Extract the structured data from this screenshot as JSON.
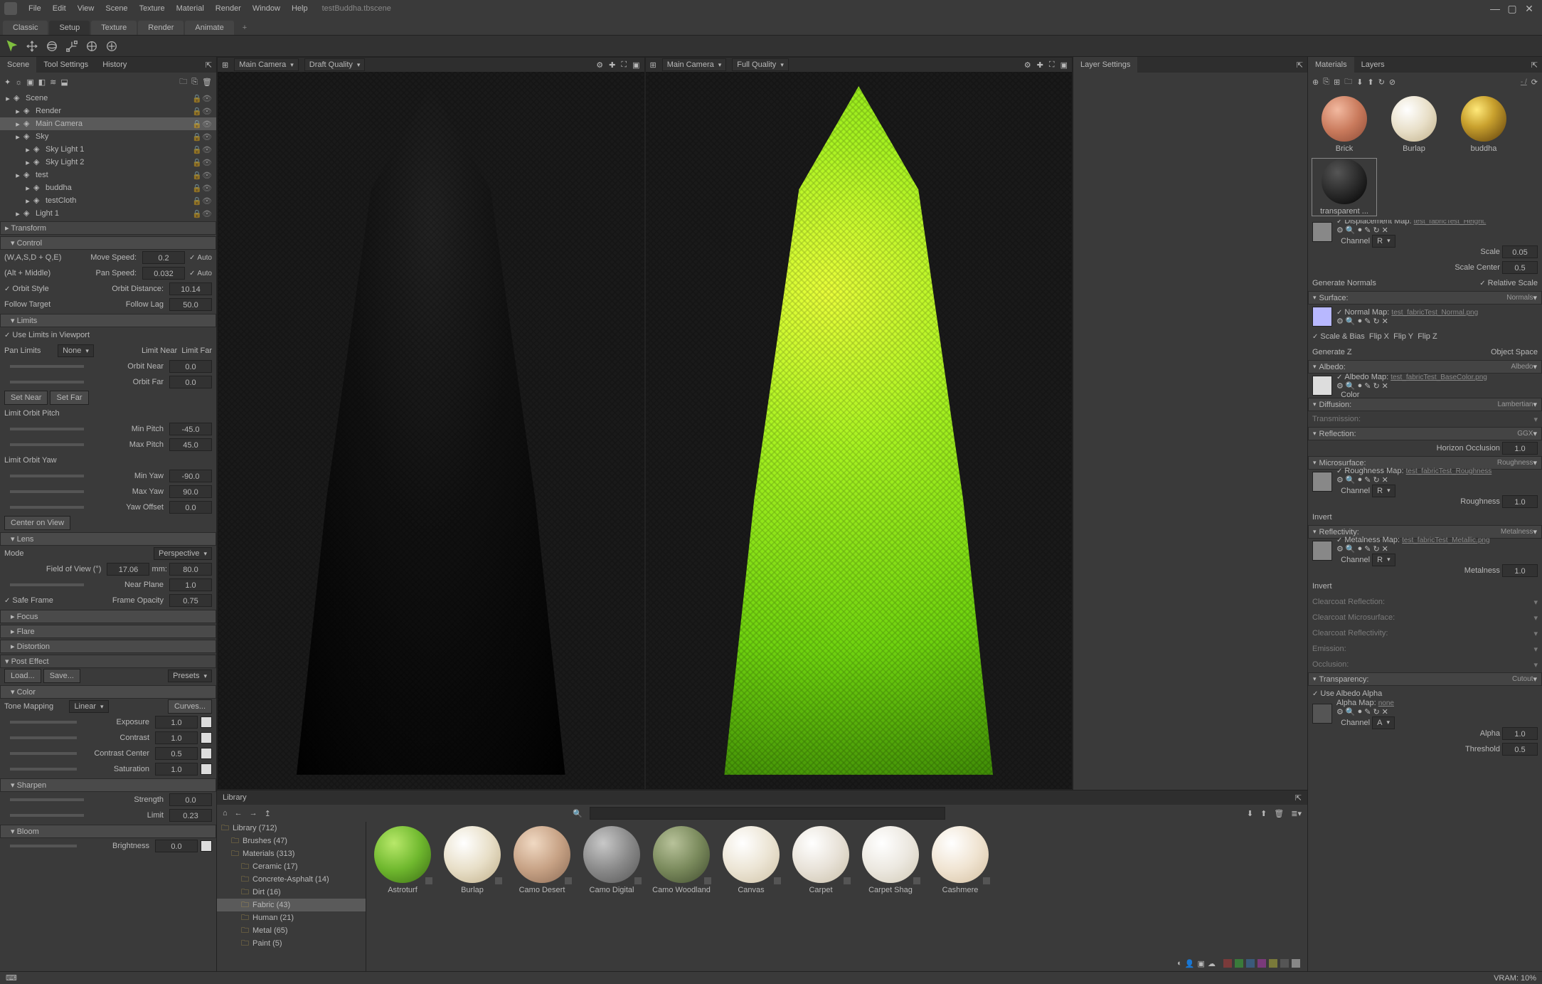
{
  "menu": {
    "items": [
      "File",
      "Edit",
      "View",
      "Scene",
      "Texture",
      "Material",
      "Render",
      "Window",
      "Help"
    ],
    "filename": "testBuddha.tbscene"
  },
  "workspace_tabs": [
    "Classic",
    "Setup",
    "Texture",
    "Render",
    "Animate"
  ],
  "workspace_active": 1,
  "left_tabs": [
    "Scene",
    "Tool Settings",
    "History"
  ],
  "hierarchy": [
    {
      "name": "Scene",
      "depth": 0,
      "sel": false,
      "icon": "scene"
    },
    {
      "name": "Render",
      "depth": 1,
      "sel": false,
      "icon": "render"
    },
    {
      "name": "Main Camera",
      "depth": 1,
      "sel": true,
      "icon": "camera"
    },
    {
      "name": "Sky",
      "depth": 1,
      "sel": false,
      "icon": "sky"
    },
    {
      "name": "Sky Light 1",
      "depth": 2,
      "sel": false,
      "icon": "light"
    },
    {
      "name": "Sky Light 2",
      "depth": 2,
      "sel": false,
      "icon": "light"
    },
    {
      "name": "test",
      "depth": 1,
      "sel": false,
      "icon": "folder"
    },
    {
      "name": "buddha",
      "depth": 2,
      "sel": false,
      "icon": "mesh"
    },
    {
      "name": "testCloth",
      "depth": 2,
      "sel": false,
      "icon": "mesh"
    },
    {
      "name": "Light 1",
      "depth": 1,
      "sel": false,
      "icon": "light"
    }
  ],
  "sections": {
    "transform": "Transform",
    "control": "Control",
    "limits": "Limits",
    "lens": "Lens",
    "focus": "Focus",
    "flare": "Flare",
    "distortion": "Distortion",
    "posteffect": "Post Effect",
    "color": "Color",
    "sharpen": "Sharpen",
    "bloom": "Bloom"
  },
  "control": {
    "wasd": "(W,A,S,D + Q,E)",
    "movespeed_lbl": "Move Speed:",
    "movespeed": "0.2",
    "auto": "Auto",
    "altmid": "(Alt + Middle)",
    "panspeed_lbl": "Pan Speed:",
    "panspeed": "0.032",
    "orbitstyle": "Orbit Style",
    "orbitdist_lbl": "Orbit Distance:",
    "orbitdist": "10.14",
    "followtarget": "Follow Target",
    "followlag_lbl": "Follow Lag",
    "followlag": "50.0"
  },
  "limits": {
    "uselimits": "Use Limits in Viewport",
    "panlimits_lbl": "Pan Limits",
    "panlimits_val": "None",
    "limitnear": "Limit Near",
    "limitfar": "Limit Far",
    "orbitnear": "Orbit Near",
    "orbitnear_v": "0.0",
    "orbitfar": "Orbit Far",
    "orbitfar_v": "0.0",
    "setnear": "Set Near",
    "setfar": "Set Far",
    "limitpitch": "Limit Orbit Pitch",
    "minpitch": "Min Pitch",
    "minpitch_v": "-45.0",
    "maxpitch": "Max Pitch",
    "maxpitch_v": "45.0",
    "limityaw": "Limit Orbit Yaw",
    "minyaw": "Min Yaw",
    "minyaw_v": "-90.0",
    "maxyaw": "Max Yaw",
    "maxyaw_v": "90.0",
    "yawoffset": "Yaw Offset",
    "yawoffset_v": "0.0",
    "centerview": "Center on View"
  },
  "lens": {
    "mode_lbl": "Mode",
    "mode": "Perspective",
    "fov_lbl": "Field of View (°)",
    "fov": "17.06",
    "mm_lbl": "mm:",
    "mm": "80.0",
    "nearplane": "Near Plane",
    "nearplane_v": "1.0",
    "safeframe": "Safe Frame",
    "frameop_lbl": "Frame Opacity",
    "frameop_v": "0.75"
  },
  "post": {
    "load": "Load...",
    "save": "Save...",
    "presets": "Presets",
    "tonemap_lbl": "Tone Mapping",
    "tonemap": "Linear",
    "curves": "Curves...",
    "exposure": "Exposure",
    "exposure_v": "1.0",
    "contrast": "Contrast",
    "contrast_v": "1.0",
    "contrastc": "Contrast Center",
    "contrastc_v": "0.5",
    "saturation": "Saturation",
    "saturation_v": "1.0",
    "strength": "Strength",
    "strength_v": "0.0",
    "limit": "Limit",
    "limit_v": "0.23",
    "brightness": "Brightness",
    "brightness_v": "0.0"
  },
  "viewport": {
    "cam": "Main Camera",
    "q1": "Draft Quality",
    "q2": "Full Quality"
  },
  "layer_tab": "Layer Settings",
  "right_tabs": [
    "Materials",
    "Layers"
  ],
  "materials": [
    {
      "name": "Brick",
      "bg": "radial-gradient(circle at 35% 30%,#f2b9a0 0%,#c97a5c 50%,#8a4a36 100%)"
    },
    {
      "name": "Burlap",
      "bg": "radial-gradient(circle at 35% 30%,#fff 0%,#e8dfc8 50%,#bfae88 100%)"
    },
    {
      "name": "buddha",
      "bg": "radial-gradient(circle at 35% 30%,#ffe97a 0%,#c9a12e 40%,#5a3a0a 100%)"
    },
    {
      "name": "transparent ...",
      "bg": "radial-gradient(circle at 35% 30%,#555 0%,#222 60%,#000 100%)",
      "sel": true
    }
  ],
  "matprops": {
    "displacement_sect": "Displacement Map:",
    "displacement_file": "test_fabricTest_Height.",
    "channel": "Channel",
    "channel_r": "R",
    "scale": "Scale",
    "scale_v": "0.05",
    "scalecenter": "Scale Center",
    "scalecenter_v": "0.5",
    "gennormals": "Generate Normals",
    "relscale": "Relative Scale",
    "surface": "Surface:",
    "surface_mode": "Normals",
    "normalmap": "Normal Map:",
    "normal_file": "test_fabricTest_Normal.png",
    "scalebias": "Scale & Bias",
    "flipx": "Flip X",
    "flipy": "Flip Y",
    "flipz": "Flip Z",
    "genz": "Generate Z",
    "objspace": "Object Space",
    "albedo": "Albedo:",
    "albedo_mode": "Albedo",
    "albedomap": "Albedo Map:",
    "albedo_file": "test_fabricTest_BaseColor.png",
    "color": "Color",
    "diffusion": "Diffusion:",
    "diffusion_mode": "Lambertian",
    "transmission": "Transmission:",
    "reflection": "Reflection:",
    "reflection_mode": "GGX",
    "horizocc": "Horizon Occlusion",
    "horizocc_v": "1.0",
    "microsurface": "Microsurface:",
    "microsurface_mode": "Roughness",
    "roughmap": "Roughness Map:",
    "rough_file": "test_fabricTest_Roughness",
    "roughness": "Roughness",
    "roughness_v": "1.0",
    "invert": "Invert",
    "reflectivity": "Reflectivity:",
    "reflectivity_mode": "Metalness",
    "metalmap": "Metalness Map:",
    "metal_file": "test_fabricTest_Metallic.png",
    "metalness": "Metalness",
    "metalness_v": "1.0",
    "ccrefl": "Clearcoat Reflection:",
    "ccmicro": "Clearcoat Microsurface:",
    "ccreflv": "Clearcoat Reflectivity:",
    "emission": "Emission:",
    "occlusion": "Occlusion:",
    "transparency": "Transparency:",
    "transparency_mode": "Cutout",
    "usealbedo": "Use Albedo Alpha",
    "alphamap": "Alpha Map:",
    "alphamap_v": "none",
    "channel_a": "A",
    "alpha": "Alpha",
    "alpha_v": "1.0",
    "threshold": "Threshold",
    "threshold_v": "0.5"
  },
  "library": {
    "title": "Library",
    "search_ph": "",
    "tree": [
      {
        "name": "Library (712)",
        "depth": 0
      },
      {
        "name": "Brushes (47)",
        "depth": 1
      },
      {
        "name": "Materials (313)",
        "depth": 1
      },
      {
        "name": "Ceramic (17)",
        "depth": 2
      },
      {
        "name": "Concrete-Asphalt (14)",
        "depth": 2
      },
      {
        "name": "Dirt (16)",
        "depth": 2
      },
      {
        "name": "Fabric (43)",
        "depth": 2,
        "sel": true
      },
      {
        "name": "Human (21)",
        "depth": 2
      },
      {
        "name": "Metal (65)",
        "depth": 2
      },
      {
        "name": "Paint (5)",
        "depth": 2
      }
    ],
    "items": [
      {
        "name": "Astroturf",
        "bg": "radial-gradient(circle at 35% 30%,#b8e86a 0%,#6fb82e 50%,#3a6a14 100%)"
      },
      {
        "name": "Burlap",
        "bg": "radial-gradient(circle at 35% 30%,#fff 0%,#e8dfc8 50%,#bfae88 100%)"
      },
      {
        "name": "Camo Desert",
        "bg": "radial-gradient(circle at 35% 30%,#f0d9c3 0%,#c7a285 50%,#8a6a54 100%)"
      },
      {
        "name": "Camo Digital",
        "bg": "radial-gradient(circle at 35% 30%,#c8c8c8 0%,#8a8a8a 50%,#555 100%)"
      },
      {
        "name": "Camo Woodland",
        "bg": "radial-gradient(circle at 35% 30%,#b8c29a 0%,#7a8a5c 50%,#3f4a2e 100%)"
      },
      {
        "name": "Canvas",
        "bg": "radial-gradient(circle at 35% 30%,#fff 0%,#ece5d5 50%,#cfc2a6 100%)"
      },
      {
        "name": "Carpet",
        "bg": "radial-gradient(circle at 35% 30%,#fff 0%,#e8e2d8 50%,#c9bfa8 100%)"
      },
      {
        "name": "Carpet Shag",
        "bg": "radial-gradient(circle at 35% 30%,#fff 0%,#ece8e0 50%,#d0c8b4 100%)"
      },
      {
        "name": "Cashmere",
        "bg": "radial-gradient(circle at 35% 30%,#fff 0%,#f0e4d2 50%,#d4bfa0 100%)"
      }
    ]
  },
  "status": {
    "vram": "VRAM: 10%"
  }
}
